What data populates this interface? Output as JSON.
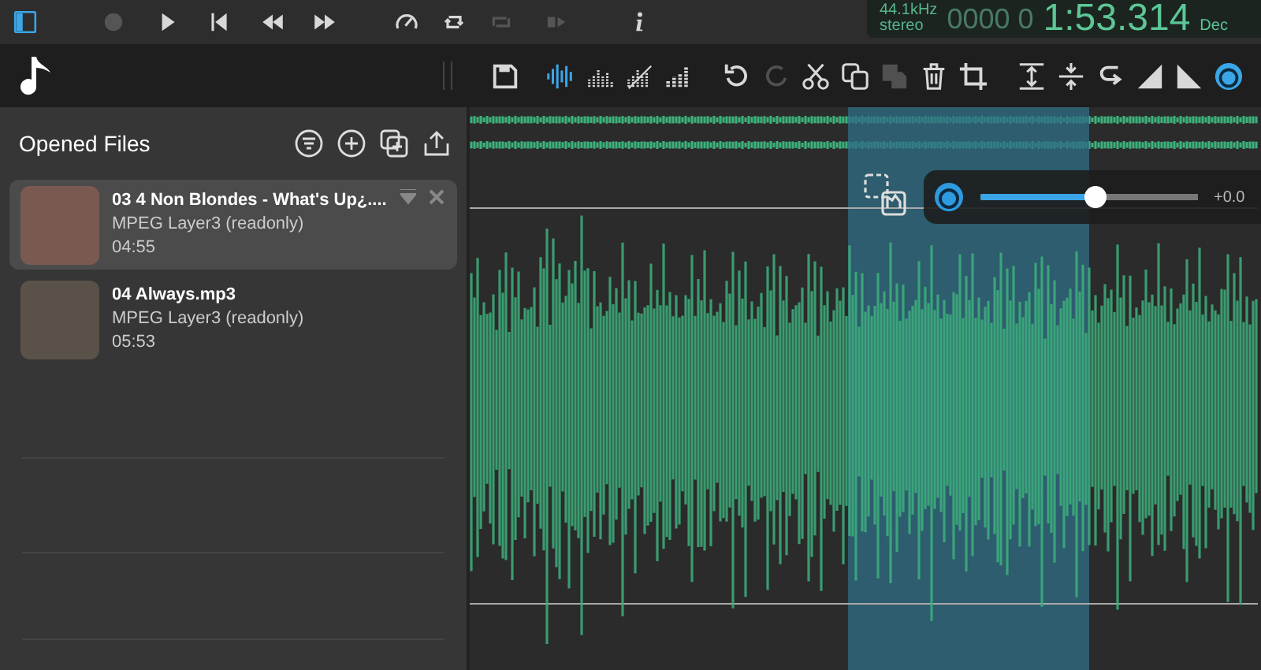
{
  "transport": [
    {
      "kind": "sidebar",
      "disabled": false,
      "selected": true
    },
    {
      "kind": "record",
      "disabled": true,
      "selected": false
    },
    {
      "kind": "play",
      "disabled": false,
      "selected": false
    },
    {
      "kind": "skip-back",
      "disabled": false,
      "selected": false
    },
    {
      "kind": "rewind",
      "disabled": false,
      "selected": false
    },
    {
      "kind": "forward",
      "disabled": false,
      "selected": false
    },
    {
      "kind": "speed",
      "disabled": false,
      "selected": false
    },
    {
      "kind": "loop",
      "disabled": false,
      "selected": false
    },
    {
      "kind": "repeat",
      "disabled": true,
      "selected": false
    },
    {
      "kind": "next",
      "disabled": true,
      "selected": false
    },
    {
      "kind": "info",
      "disabled": false,
      "selected": false
    }
  ],
  "display": {
    "sample_rate": "44.1kHz",
    "channels": "stereo",
    "time_placeholder": "0000 0",
    "time": "1:53.314",
    "unit": "Dec"
  },
  "toolbar": [
    {
      "kind": "save",
      "disabled": false,
      "selected": false
    },
    {
      "kind": "waveform",
      "disabled": false,
      "selected": true
    },
    {
      "kind": "spectrum",
      "disabled": false,
      "selected": false
    },
    {
      "kind": "spectrum-off",
      "disabled": false,
      "selected": false
    },
    {
      "kind": "bars",
      "disabled": false,
      "selected": false
    },
    {
      "kind": "undo",
      "disabled": false,
      "selected": false
    },
    {
      "kind": "redo",
      "disabled": true,
      "selected": false
    },
    {
      "kind": "cut",
      "disabled": false,
      "selected": false
    },
    {
      "kind": "copy",
      "disabled": false,
      "selected": false
    },
    {
      "kind": "paste",
      "disabled": true,
      "selected": false
    },
    {
      "kind": "delete",
      "disabled": false,
      "selected": false
    },
    {
      "kind": "crop",
      "disabled": false,
      "selected": false
    },
    {
      "kind": "expand",
      "disabled": false,
      "selected": false
    },
    {
      "kind": "compress",
      "disabled": false,
      "selected": false
    },
    {
      "kind": "wrap",
      "disabled": false,
      "selected": false
    },
    {
      "kind": "fade-in",
      "disabled": false,
      "selected": false
    },
    {
      "kind": "fade-out",
      "disabled": false,
      "selected": false
    },
    {
      "kind": "gain",
      "disabled": false,
      "selected": true
    }
  ],
  "sidebar": {
    "title": "Opened Files",
    "files": [
      {
        "title": "03 4 Non Blondes - What's Up¿....",
        "format": "MPEG Layer3 (readonly)",
        "duration": "04:55",
        "selected": true
      },
      {
        "title": "04 Always.mp3",
        "format": "MPEG Layer3 (readonly)",
        "duration": "05:53",
        "selected": false
      }
    ]
  },
  "gain": {
    "level": 0.53,
    "reading": "+0.0"
  }
}
